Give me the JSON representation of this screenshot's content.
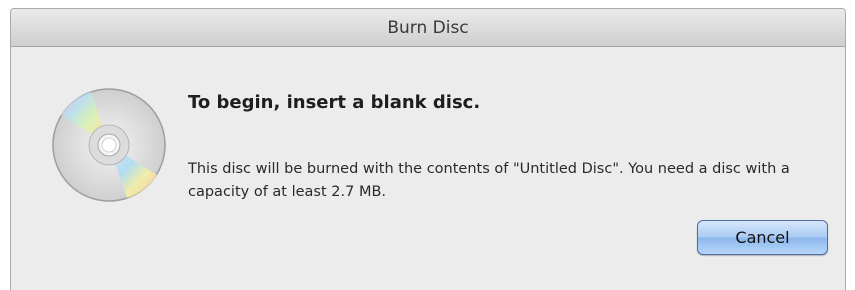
{
  "window": {
    "title": "Burn Disc"
  },
  "dialog": {
    "icon": "cd-disc-icon",
    "heading": "To begin, insert a blank disc.",
    "message": "This disc will be burned with the contents of \"Untitled Disc\". You need a disc with a capacity of at least 2.7 MB.",
    "cancel_label": "Cancel"
  },
  "colors": {
    "window_background": "#ececec",
    "default_button_blue": "#a9caf2"
  }
}
